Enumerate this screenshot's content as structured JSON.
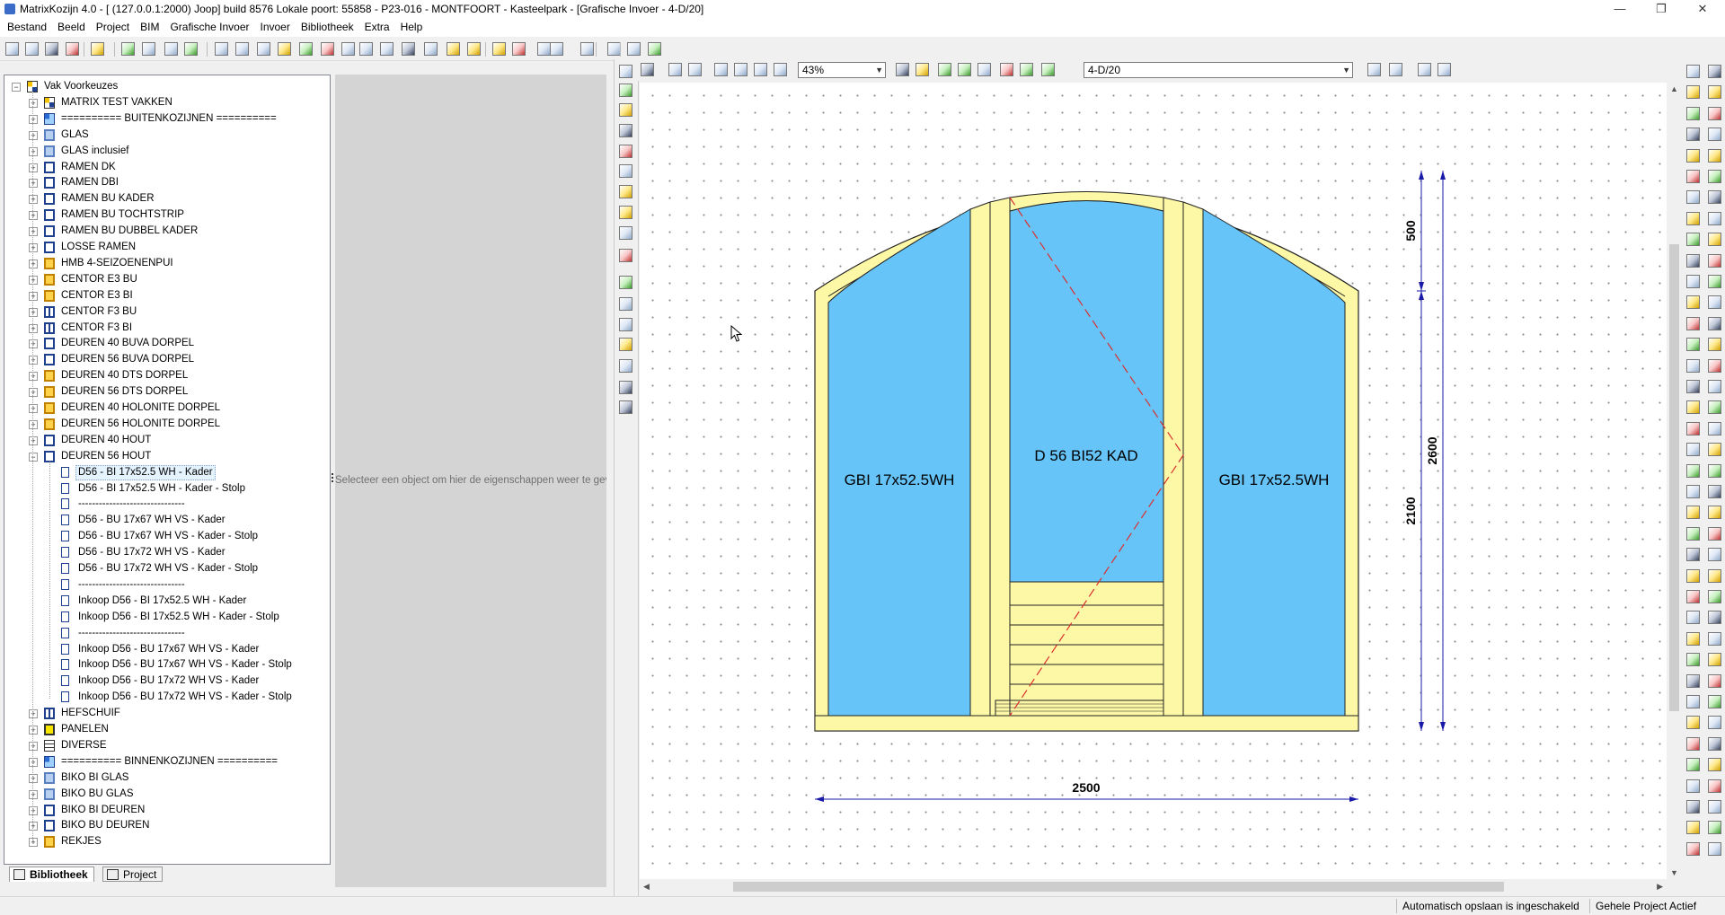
{
  "window": {
    "title": "MatrixKozijn 4.0 - [ (127.0.0.1:2000) Joop] build  8576 Lokale poort: 55858 - P23-016 - MONTFOORT - Kasteelpark - [Grafische Invoer - 4-D/20]",
    "minimize": "—",
    "maximize": "❐",
    "close": "✕"
  },
  "menu": [
    "Bestand",
    "Beeld",
    "Project",
    "BIM",
    "Grafische Invoer",
    "Invoer",
    "Bibliotheek",
    "Extra",
    "Help"
  ],
  "tree": {
    "root": "Vak Voorkeuzes",
    "items": [
      {
        "label": "MATRIX TEST VAKKEN",
        "icon": "matrix-icon"
      },
      {
        "label": "========== BUITENKOZIJNEN ==========",
        "icon": "separator-icon"
      },
      {
        "label": "GLAS",
        "icon": "glass-icon"
      },
      {
        "label": "GLAS inclusief",
        "icon": "glass-icon"
      },
      {
        "label": "RAMEN DK",
        "icon": "window-icon"
      },
      {
        "label": "RAMEN DBI",
        "icon": "window-icon"
      },
      {
        "label": "RAMEN BU KADER",
        "icon": "window-icon"
      },
      {
        "label": "RAMEN BU TOCHTSTRIP",
        "icon": "window-icon"
      },
      {
        "label": "RAMEN BU DUBBEL KADER",
        "icon": "window-icon"
      },
      {
        "label": "LOSSE RAMEN",
        "icon": "window-icon"
      },
      {
        "label": "HMB 4-SEIZOENENPUI",
        "icon": "door-yellow-icon"
      },
      {
        "label": "CENTOR E3 BU",
        "icon": "door-yellow-icon"
      },
      {
        "label": "CENTOR E3 BI",
        "icon": "door-yellow-icon"
      },
      {
        "label": "CENTOR F3 BU",
        "icon": "double-door-icon"
      },
      {
        "label": "CENTOR F3 BI",
        "icon": "double-door-icon"
      },
      {
        "label": "DEUREN 40 BUVA DORPEL",
        "icon": "window-icon"
      },
      {
        "label": "DEUREN 56 BUVA DORPEL",
        "icon": "window-icon"
      },
      {
        "label": "DEUREN 40 DTS DORPEL",
        "icon": "door-yellow-icon"
      },
      {
        "label": "DEUREN 56 DTS DORPEL",
        "icon": "door-yellow-icon"
      },
      {
        "label": "DEUREN 40 HOLONITE DORPEL",
        "icon": "door-yellow-icon"
      },
      {
        "label": "DEUREN 56 HOLONITE DORPEL",
        "icon": "door-yellow-icon"
      },
      {
        "label": "DEUREN 40 HOUT",
        "icon": "window-icon"
      },
      {
        "label": "DEUREN 56 HOUT",
        "icon": "window-icon"
      }
    ],
    "children": [
      "D56 - BI 17x52.5 WH - Kader",
      "D56 - BI 17x52.5 WH - Kader - Stolp",
      "-------------------------------",
      "D56 - BU 17x67 WH VS - Kader",
      "D56 - BU 17x67 WH VS - Kader - Stolp",
      "D56 - BU 17x72 WH VS - Kader",
      "D56 - BU 17x72 WH VS - Kader - Stolp",
      "-------------------------------",
      "Inkoop D56 - BI 17x52.5 WH - Kader",
      "Inkoop D56 - BI 17x52.5 WH - Kader - Stolp",
      "-------------------------------",
      "Inkoop D56 - BU 17x67 WH VS - Kader",
      "Inkoop D56 - BU 17x67 WH VS - Kader - Stolp",
      "Inkoop D56 - BU 17x72 WH VS - Kader",
      "Inkoop D56 - BU 17x72 WH VS - Kader - Stolp"
    ],
    "after": [
      {
        "label": "HEFSCHUIF",
        "icon": "double-door-icon"
      },
      {
        "label": "PANELEN",
        "icon": "panel-icon"
      },
      {
        "label": "DIVERSE",
        "icon": "grid-icon"
      },
      {
        "label": "========== BINNENKOZIJNEN ==========",
        "icon": "separator-icon"
      },
      {
        "label": "BIKO BI GLAS",
        "icon": "glass-icon"
      },
      {
        "label": "BIKO BU GLAS",
        "icon": "glass-icon"
      },
      {
        "label": "BIKO BI DEUREN",
        "icon": "window-icon"
      },
      {
        "label": "BIKO BU DEUREN",
        "icon": "window-icon"
      },
      {
        "label": "REKJES",
        "icon": "rack-icon"
      }
    ],
    "selected_child": 0
  },
  "bottom_tabs": [
    "Bibliotheek",
    "Project"
  ],
  "properties_hint": "Selecteer een object om hier de eigenschappen weer te geven",
  "zoom": "43%",
  "sheet": "4-D/20",
  "drawing": {
    "left_glass": "GBI 17x52.5WH",
    "center_label": "D 56 BI52 KAD",
    "right_glass": "GBI 17x52.5WH",
    "dim_width": "2500",
    "dim_arch": "500",
    "dim_lower": "2100",
    "dim_total": "2600"
  },
  "status": {
    "autosave": "Automatisch opslaan is ingeschakeld",
    "project": "Gehele Project Actief"
  },
  "colors": {
    "frame": "#fdf8a6",
    "glass": "#66c4f8",
    "dimension": "#1a1aa8",
    "swing": "#d93030"
  }
}
